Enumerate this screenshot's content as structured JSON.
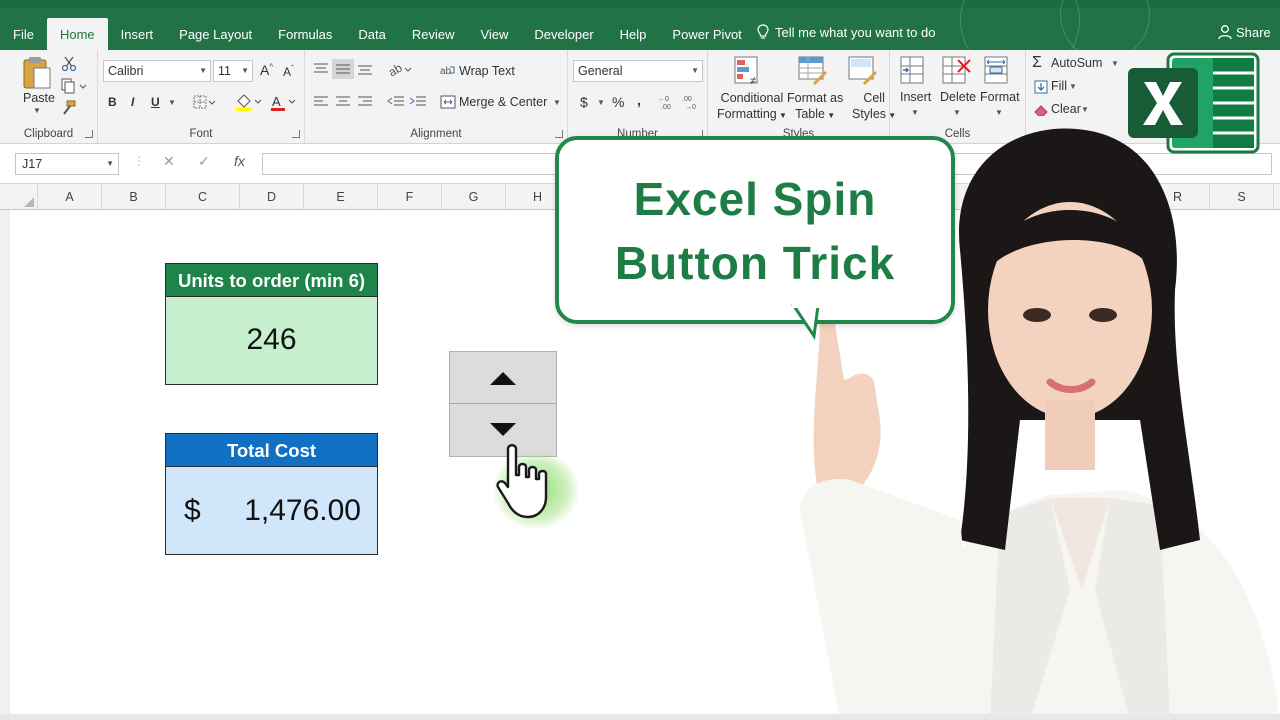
{
  "app": {
    "brand_color": "#217346",
    "tabs": [
      {
        "label": "File"
      },
      {
        "label": "Home"
      },
      {
        "label": "Insert"
      },
      {
        "label": "Page Layout"
      },
      {
        "label": "Formulas"
      },
      {
        "label": "Data"
      },
      {
        "label": "Review"
      },
      {
        "label": "View"
      },
      {
        "label": "Developer"
      },
      {
        "label": "Help"
      },
      {
        "label": "Power Pivot"
      }
    ],
    "active_tab": "Home",
    "tell_me": "Tell me what you want to do",
    "share": "Share"
  },
  "ribbon": {
    "clipboard": {
      "label": "Clipboard",
      "paste": "Paste"
    },
    "font": {
      "label": "Font",
      "font_name": "Calibri",
      "font_size": "11",
      "bold": "B",
      "italic": "I",
      "underline": "U"
    },
    "alignment": {
      "label": "Alignment",
      "wrap_text": "Wrap Text",
      "merge_center": "Merge & Center"
    },
    "number": {
      "label": "Number",
      "format": "General",
      "currency": "$",
      "percent": "%",
      "comma": ","
    },
    "styles": {
      "label": "Styles",
      "conditional_line1": "Conditional",
      "conditional_line2": "Formatting",
      "table_line1": "Format as",
      "table_line2": "Table",
      "cell_line1": "Cell",
      "cell_line2": "Styles"
    },
    "cells": {
      "label": "Cells",
      "insert": "Insert",
      "delete": "Delete",
      "format": "Format"
    },
    "editing": {
      "autosum": "AutoSum",
      "fill": "Fill",
      "clear": "Clear"
    }
  },
  "formula_bar": {
    "name_box": "J17",
    "cancel": "✕",
    "enter": "✓",
    "fx": "fx",
    "value": ""
  },
  "columns": [
    "A",
    "B",
    "C",
    "D",
    "E",
    "F",
    "G",
    "H",
    "R",
    "S"
  ],
  "sheet": {
    "units_header": "Units to order (min 6)",
    "units_value": "246",
    "cost_header": "Total Cost",
    "cost_symbol": "$",
    "cost_value": "1,476.00"
  },
  "spin_button": {
    "up_icon": "triangle-up-icon",
    "down_icon": "triangle-down-icon"
  },
  "callout": {
    "line1": "Excel Spin",
    "line2": "Button Trick"
  },
  "colors": {
    "units_header_bg": "#1e8449",
    "units_body_bg": "#c6efce",
    "cost_header_bg": "#1070c4",
    "cost_body_bg": "#cfe6fb",
    "callout_text": "#1e7d45"
  }
}
